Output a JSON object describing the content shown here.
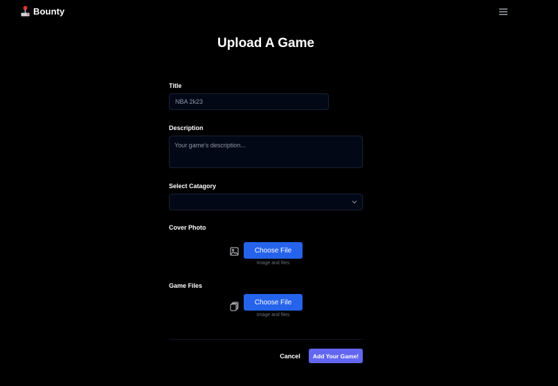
{
  "header": {
    "brand": "Bounty",
    "brand_icon": "joystick-icon",
    "menu_icon": "hamburger-menu-icon"
  },
  "page_title": "Upload A Game",
  "form": {
    "title": {
      "label": "Title",
      "value": "",
      "placeholder": "NBA 2k23"
    },
    "description": {
      "label": "Description",
      "value": "",
      "placeholder": "Your game's description..."
    },
    "category": {
      "label": "Select Catagory",
      "selected": ""
    },
    "cover_photo": {
      "label": "Cover Photo",
      "icon": "image-icon",
      "button": "Choose File",
      "hint": "Image and files"
    },
    "game_files": {
      "label": "Game Files",
      "icon": "files-icon",
      "button": "Choose File",
      "hint": "Image and files"
    },
    "actions": {
      "cancel": "Cancel",
      "submit": "Add Your Game!"
    }
  },
  "colors": {
    "background": "#000000",
    "field_background": "#030816",
    "field_border": "#1b2336",
    "primary_blue": "#2563eb",
    "submit_indigo": "#6366f1",
    "hint_gray": "#6b7280"
  }
}
